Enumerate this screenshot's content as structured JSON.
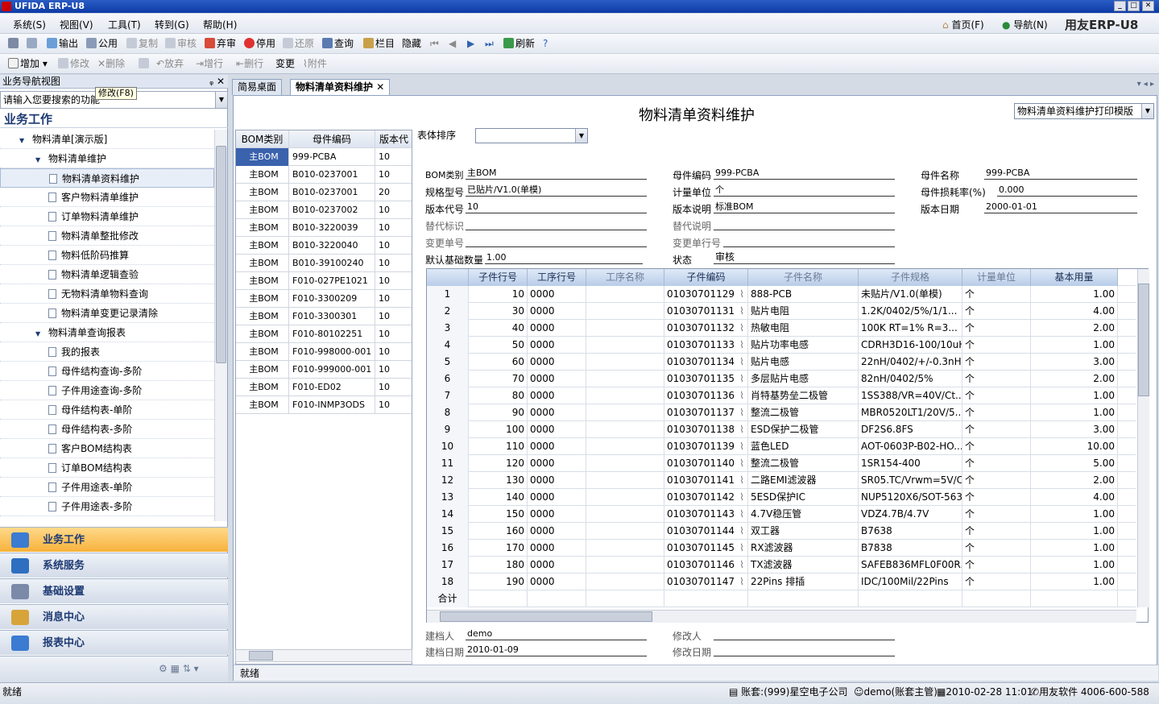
{
  "window": {
    "title": "UFIDA ERP-U8",
    "brand": "用友ERP-U8",
    "home": "首页(F)",
    "nav": "导航(N)"
  },
  "menu": [
    "系统(S)",
    "视图(V)",
    "工具(T)",
    "转到(G)",
    "帮助(H)"
  ],
  "toolbar1": {
    "print": "",
    "preview": "",
    "export": "输出",
    "public": "公用",
    "copy": "复制",
    "audit": "审核",
    "abandon": "弃审",
    "stop": "停用",
    "restore": "还原",
    "query": "查询",
    "column": "栏目",
    "hide": "隐藏",
    "refresh": "刷新"
  },
  "toolbar2": {
    "add": "增加",
    "modify": "修改",
    "delete": "删除",
    "giveup": "放弃",
    "addrow": "增行",
    "delrow": "删行",
    "change": "变更",
    "attach": "附件"
  },
  "tooltip": "修改(F8)",
  "left": {
    "header": "业务导航视图",
    "search_placeholder": "请输入您要搜索的功能",
    "section": "业务工作",
    "tree": [
      {
        "label": "物料清单[演示版]",
        "level": 1,
        "type": "folder"
      },
      {
        "label": "物料清单维护",
        "level": 2,
        "type": "folder"
      },
      {
        "label": "物料清单资料维护",
        "level": 3,
        "type": "leaf",
        "selected": true
      },
      {
        "label": "客户物料清单维护",
        "level": 3,
        "type": "leaf"
      },
      {
        "label": "订单物料清单维护",
        "level": 3,
        "type": "leaf"
      },
      {
        "label": "物料清单整批修改",
        "level": 3,
        "type": "leaf"
      },
      {
        "label": "物料低阶码推算",
        "level": 3,
        "type": "leaf"
      },
      {
        "label": "物料清单逻辑查验",
        "level": 3,
        "type": "leaf"
      },
      {
        "label": "无物料清单物料查询",
        "level": 3,
        "type": "leaf"
      },
      {
        "label": "物料清单变更记录清除",
        "level": 3,
        "type": "leaf"
      },
      {
        "label": "物料清单查询报表",
        "level": 2,
        "type": "folder"
      },
      {
        "label": "我的报表",
        "level": 3,
        "type": "leaf"
      },
      {
        "label": "母件结构查询-多阶",
        "level": 3,
        "type": "leaf"
      },
      {
        "label": "子件用途查询-多阶",
        "level": 3,
        "type": "leaf"
      },
      {
        "label": "母件结构表-单阶",
        "level": 3,
        "type": "leaf"
      },
      {
        "label": "母件结构表-多阶",
        "level": 3,
        "type": "leaf"
      },
      {
        "label": "客户BOM结构表",
        "level": 3,
        "type": "leaf"
      },
      {
        "label": "订单BOM结构表",
        "level": 3,
        "type": "leaf"
      },
      {
        "label": "子件用途表-单阶",
        "level": 3,
        "type": "leaf"
      },
      {
        "label": "子件用途表-多阶",
        "level": 3,
        "type": "leaf"
      }
    ],
    "nav": [
      {
        "label": "业务工作",
        "active": true,
        "color": "#3b7bd1"
      },
      {
        "label": "系统服务",
        "color": "#2e6fc0"
      },
      {
        "label": "基础设置",
        "color": "#7b8aa8"
      },
      {
        "label": "消息中心",
        "color": "#d7a43a"
      },
      {
        "label": "报表中心",
        "color": "#3b7bd1"
      }
    ]
  },
  "tabs": [
    "简易桌面",
    "物料清单资料维护"
  ],
  "form": {
    "title": "物料清单资料维护",
    "template": "物料清单资料维护打印模版",
    "sort_label": "表体排序",
    "bom_type_label": "BOM类别",
    "bom_type": "主BOM",
    "parent_code_label": "母件编码",
    "parent_code": "999-PCBA",
    "parent_name_label": "母件名称",
    "parent_name": "999-PCBA",
    "spec_label": "规格型号",
    "spec": "已贴片/V1.0(单模)",
    "unit_label": "计量单位",
    "unit": "个",
    "loss_label": "母件损耗率(%)",
    "loss": "0.000",
    "version_label": "版本代号",
    "version": "10",
    "version_desc_label": "版本说明",
    "version_desc": "标准BOM",
    "version_date_label": "版本日期",
    "version_date": "2000-01-01",
    "alt_label": "替代标识",
    "alt": "",
    "alt_desc_label": "替代说明",
    "alt_desc": "",
    "change_no_label": "变更单号",
    "change_no": "",
    "change_row_label": "变更单行号",
    "change_row": "",
    "base_qty_label": "默认基础数量",
    "base_qty": "1.00",
    "status_label": "状态",
    "status": "审核",
    "creator_label": "建档人",
    "creator": "demo",
    "modifier_label": "修改人",
    "modifier": "",
    "created_label": "建档日期",
    "created": "2010-01-09",
    "modified_label": "修改日期",
    "modified": ""
  },
  "bom_list": {
    "headers": [
      "BOM类别",
      "母件编码",
      "版本代"
    ],
    "rows": [
      [
        "主BOM",
        "999-PCBA",
        "10"
      ],
      [
        "主BOM",
        "B010-0237001",
        "10"
      ],
      [
        "主BOM",
        "B010-0237001",
        "20"
      ],
      [
        "主BOM",
        "B010-0237002",
        "10"
      ],
      [
        "主BOM",
        "B010-3220039",
        "10"
      ],
      [
        "主BOM",
        "B010-3220040",
        "10"
      ],
      [
        "主BOM",
        "B010-39100240",
        "10"
      ],
      [
        "主BOM",
        "F010-027PE1021",
        "10"
      ],
      [
        "主BOM",
        "F010-3300209",
        "10"
      ],
      [
        "主BOM",
        "F010-3300301",
        "10"
      ],
      [
        "主BOM",
        "F010-80102251",
        "10"
      ],
      [
        "主BOM",
        "F010-998000-001",
        "10"
      ],
      [
        "主BOM",
        "F010-999000-001",
        "10"
      ],
      [
        "主BOM",
        "F010-ED02",
        "10"
      ],
      [
        "主BOM",
        "F010-INMP3ODS",
        "10"
      ]
    ]
  },
  "grid": {
    "headers": [
      "",
      "子件行号",
      "工序行号",
      "工序名称",
      "子件编码",
      "子件名称",
      "子件规格",
      "计量单位",
      "基本用量"
    ],
    "gray_headers": [
      3,
      5,
      6,
      7
    ],
    "rows": [
      [
        "1",
        "10",
        "0000",
        "",
        "01030701129",
        "888-PCB",
        "未贴片/V1.0(单模)",
        "个",
        "1.00"
      ],
      [
        "2",
        "30",
        "0000",
        "",
        "01030701131",
        "贴片电阻",
        "1.2K/0402/5%/1/1...",
        "个",
        "4.00"
      ],
      [
        "3",
        "40",
        "0000",
        "",
        "01030701132",
        "热敏电阻",
        "100K RT=1% R=3...",
        "个",
        "2.00"
      ],
      [
        "4",
        "50",
        "0000",
        "",
        "01030701133",
        "贴片功率电感",
        "CDRH3D16-100/10uH",
        "个",
        "1.00"
      ],
      [
        "5",
        "60",
        "0000",
        "",
        "01030701134",
        "贴片电感",
        "22nH/0402/+/-0.3nH",
        "个",
        "3.00"
      ],
      [
        "6",
        "70",
        "0000",
        "",
        "01030701135",
        "多层贴片电感",
        "82nH/0402/5%",
        "个",
        "2.00"
      ],
      [
        "7",
        "80",
        "0000",
        "",
        "01030701136",
        "肖特基势垒二极管",
        "1SS388/VR=40V/Ct...",
        "个",
        "1.00"
      ],
      [
        "8",
        "90",
        "0000",
        "",
        "01030701137",
        "整流二极管",
        "MBR0520LT1/20V/5...",
        "个",
        "1.00"
      ],
      [
        "9",
        "100",
        "0000",
        "",
        "01030701138",
        "ESD保护二极管",
        "DF2S6.8FS",
        "个",
        "3.00"
      ],
      [
        "10",
        "110",
        "0000",
        "",
        "01030701139",
        "蓝色LED",
        "AOT-0603P-B02-HO...",
        "个",
        "10.00"
      ],
      [
        "11",
        "120",
        "0000",
        "",
        "01030701140",
        "整流二极管",
        "1SR154-400",
        "个",
        "5.00"
      ],
      [
        "12",
        "130",
        "0000",
        "",
        "01030701141",
        "二路EMI滤波器",
        "SR05.TC/Vrwm=5V/Cj",
        "个",
        "2.00"
      ],
      [
        "13",
        "140",
        "0000",
        "",
        "01030701142",
        "5ESD保护IC",
        "NUP5120X6/SOT-563",
        "个",
        "4.00"
      ],
      [
        "14",
        "150",
        "0000",
        "",
        "01030701143",
        "4.7V稳压管",
        "VDZ4.7B/4.7V",
        "个",
        "1.00"
      ],
      [
        "15",
        "160",
        "0000",
        "",
        "01030701144",
        "双工器",
        "B7638",
        "个",
        "1.00"
      ],
      [
        "16",
        "170",
        "0000",
        "",
        "01030701145",
        "RX滤波器",
        "B7838",
        "个",
        "1.00"
      ],
      [
        "17",
        "180",
        "0000",
        "",
        "01030701146",
        "TX滤波器",
        "SAFEB836MFL0F00R...",
        "个",
        "1.00"
      ],
      [
        "18",
        "190",
        "0000",
        "",
        "01030701147",
        "22Pins 排插",
        "IDC/100Mil/22Pins",
        "个",
        "1.00"
      ]
    ],
    "total_label": "合计"
  },
  "status_inner": "就绪",
  "statusbar": {
    "left": "就绪",
    "account": "账套:(999)星空电子公司",
    "user": "demo(账套主管)",
    "datetime": "2010-02-28 11:01",
    "vendor": "用友软件 4006-600-588"
  }
}
